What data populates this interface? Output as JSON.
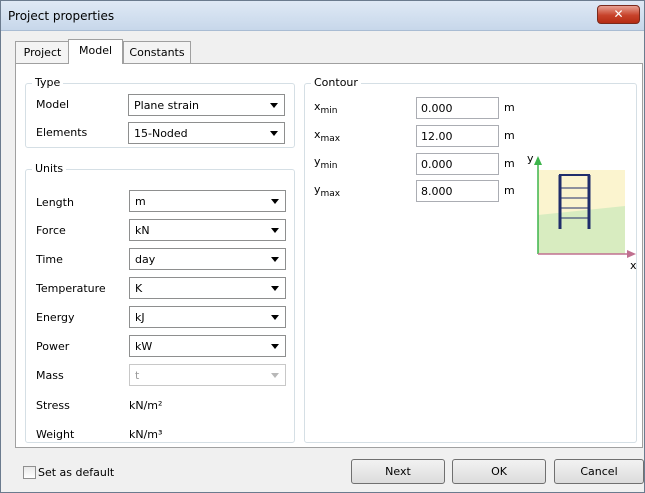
{
  "window": {
    "title": "Project properties",
    "close_label": "✕"
  },
  "tabs": [
    {
      "label": "Project",
      "active": false
    },
    {
      "label": "Model",
      "active": true
    },
    {
      "label": "Constants",
      "active": false
    }
  ],
  "type_group": {
    "legend": "Type",
    "rows": [
      {
        "label": "Model",
        "value": "Plane strain"
      },
      {
        "label": "Elements",
        "value": "15-Noded"
      }
    ]
  },
  "units_group": {
    "legend": "Units",
    "rows": [
      {
        "label": "Length",
        "value": "m",
        "enabled": true
      },
      {
        "label": "Force",
        "value": "kN",
        "enabled": true
      },
      {
        "label": "Time",
        "value": "day",
        "enabled": true
      },
      {
        "label": "Temperature",
        "value": "K",
        "enabled": true
      },
      {
        "label": "Energy",
        "value": "kJ",
        "enabled": true
      },
      {
        "label": "Power",
        "value": "kW",
        "enabled": true
      },
      {
        "label": "Mass",
        "value": "t",
        "enabled": false
      }
    ],
    "static_rows": [
      {
        "label": "Stress",
        "value": "kN/m²"
      },
      {
        "label": "Weight",
        "value": "kN/m³"
      }
    ]
  },
  "contour_group": {
    "legend": "Contour",
    "rows": [
      {
        "var": "x",
        "sub": "min",
        "value": "0.000",
        "unit": "m"
      },
      {
        "var": "x",
        "sub": "max",
        "value": "12.00",
        "unit": "m"
      },
      {
        "var": "y",
        "sub": "min",
        "value": "0.000",
        "unit": "m"
      },
      {
        "var": "y",
        "sub": "max",
        "value": "8.000",
        "unit": "m"
      }
    ],
    "axis_y": "y",
    "axis_x": "x"
  },
  "footer": {
    "set_default_label": "Set as default",
    "set_default_checked": false,
    "next_label": "Next",
    "ok_label": "OK",
    "cancel_label": "Cancel"
  },
  "colors": {
    "close_button": "#c7422a",
    "sketch_sky": "#fbf4cf",
    "sketch_ground": "#d8ecc0",
    "sketch_axis_y": "#3cb44b",
    "sketch_axis_x": "#c07090",
    "sketch_wall": "#1f2d6b"
  }
}
